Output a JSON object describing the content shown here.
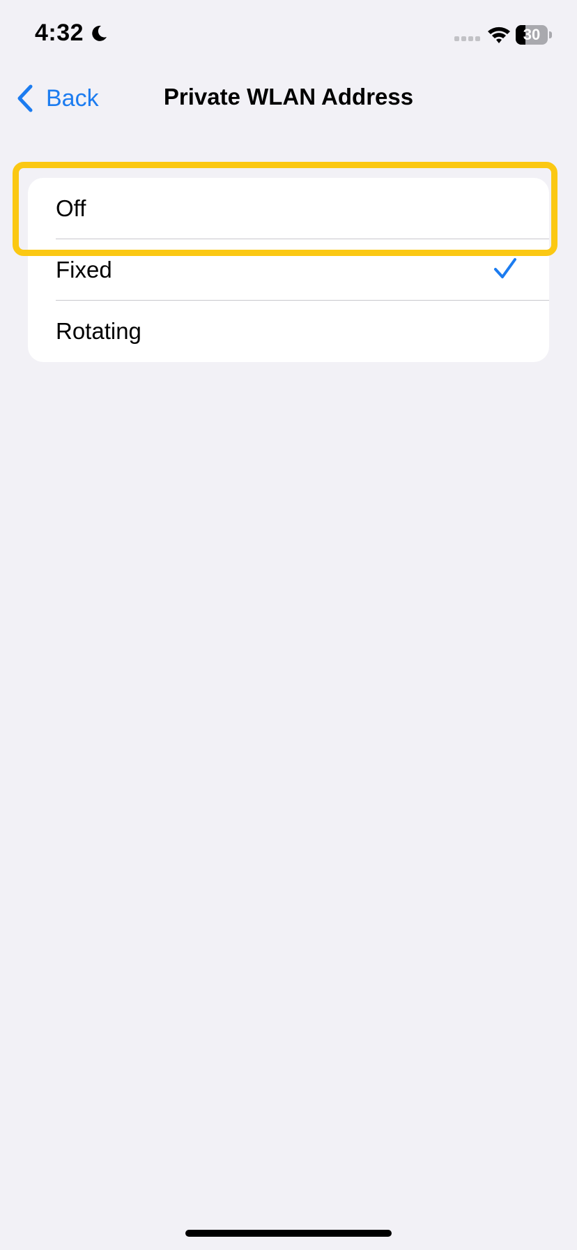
{
  "status_bar": {
    "time": "4:32",
    "battery_level": "30",
    "battery_fraction": 0.3,
    "icons": [
      "moon-icon",
      "cellular-signal-icon",
      "wifi-icon",
      "battery-icon"
    ]
  },
  "nav": {
    "back_label": "Back",
    "title": "Private WLAN Address",
    "accent_color": "#1c7cf0"
  },
  "options": [
    {
      "label": "Off",
      "selected": false
    },
    {
      "label": "Fixed",
      "selected": true
    },
    {
      "label": "Rotating",
      "selected": false
    }
  ],
  "highlight": {
    "target": "Off",
    "color": "#fbc813"
  },
  "colors": {
    "background": "#f2f1f6",
    "card": "#ffffff",
    "checkmark": "#1c7cf0"
  }
}
